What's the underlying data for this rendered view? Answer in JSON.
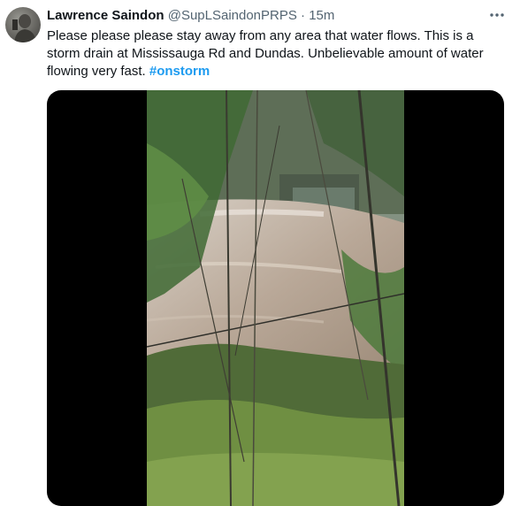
{
  "author": {
    "display_name": "Lawrence Saindon",
    "handle": "@SupLSaindonPRPS",
    "separator": "·",
    "timestamp": "15m"
  },
  "tweet": {
    "text": "Please please please stay away from any area that water flows. This is a storm drain at Mississauga Rd and Dundas. Unbelievable amount of water flowing very fast. ",
    "hashtag": "#onstorm"
  },
  "icons": {
    "more": "more-horizontal-icon",
    "avatar": "avatar-photo"
  },
  "colors": {
    "link": "#1d9bf0",
    "secondary_text": "#536471",
    "primary_text": "#0f1419",
    "media_background": "#000000"
  }
}
